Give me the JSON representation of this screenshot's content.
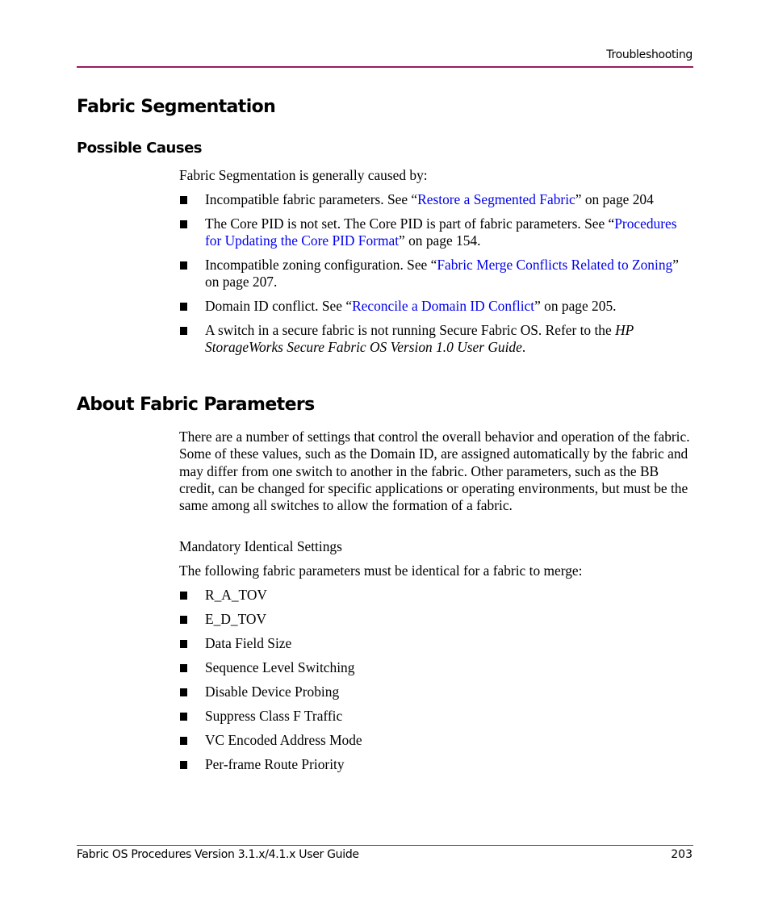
{
  "header": {
    "section": "Troubleshooting",
    "rule_color": "#9b1a5d"
  },
  "sections": {
    "fabric_segmentation": {
      "title": "Fabric Segmentation",
      "subsection_title": "Possible Causes",
      "intro": "Fabric Segmentation is generally caused by:",
      "causes": [
        {
          "before": "Incompatible fabric parameters. See “",
          "link": "Restore a Segmented Fabric",
          "after": "” on page 204"
        },
        {
          "before": "The Core PID is not set. The Core PID is part of fabric parameters. See “",
          "link": "Procedures for Updating the Core PID Format",
          "after": "” on page 154."
        },
        {
          "before": "Incompatible zoning configuration. See “",
          "link": "Fabric Merge Conflicts Related to Zoning",
          "after": "” on page 207."
        },
        {
          "before": "Domain ID conflict. See “",
          "link": "Reconcile a Domain ID Conflict",
          "after": "” on page 205."
        },
        {
          "before": "A switch in a secure fabric is not running Secure Fabric OS. Refer to the ",
          "italic": "HP StorageWorks Secure Fabric OS Version 1.0 User Guide",
          "after": "."
        }
      ]
    },
    "about_fabric_parameters": {
      "title": "About Fabric Parameters",
      "paragraph": "There are a number of settings that control the overall behavior and operation of the fabric. Some of these values, such as the Domain ID, are assigned automatically by the fabric and may differ from one switch to another in the fabric. Other parameters, such as the BB credit, can be changed for specific applications or operating environments, but must be the same among all switches to allow the formation of a fabric.",
      "mandatory_label": "Mandatory Identical Settings",
      "lead_in": "The following fabric parameters must be identical for a fabric to merge:",
      "parameters": [
        "R_A_TOV",
        "E_D_TOV",
        "Data Field Size",
        "Sequence Level Switching",
        "Disable Device Probing",
        "Suppress Class F Traffic",
        "VC Encoded Address Mode",
        "Per-frame Route Priority"
      ]
    }
  },
  "footer": {
    "guide_title": "Fabric OS Procedures Version 3.1.x/4.1.x User Guide",
    "page_number": "203"
  },
  "colors": {
    "link": "#0000ee",
    "accent_rule": "#9b1a5d"
  }
}
